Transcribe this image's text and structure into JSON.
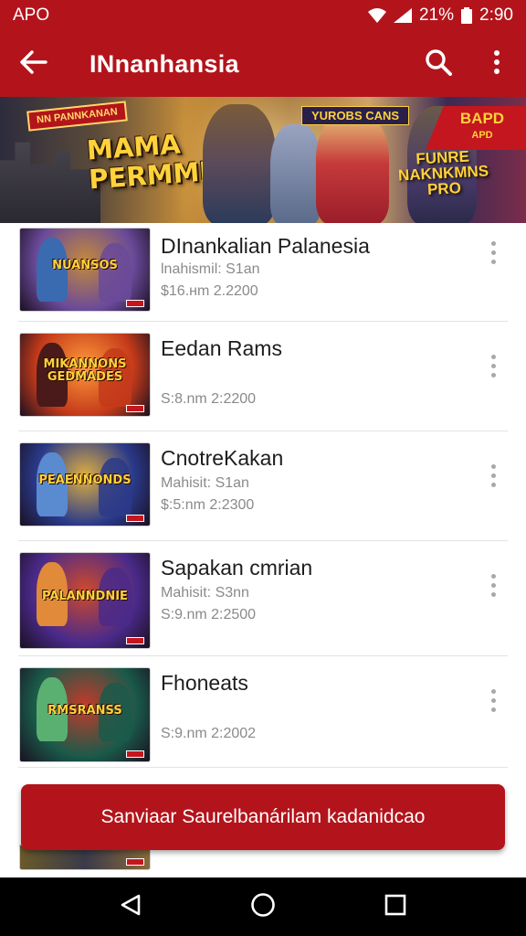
{
  "status_bar": {
    "carrier": "APO",
    "battery": "21%",
    "time": "2:90",
    "icons": [
      "wifi-icon",
      "signal-icon",
      "battery-icon"
    ]
  },
  "app_bar": {
    "title": "INnanhansia",
    "icons": [
      "back-arrow-icon",
      "search-icon",
      "more-vert-icon"
    ]
  },
  "banner": {
    "corner_tag": "NN PANNKANAN",
    "headline_line1": "MAMA",
    "headline_line2": "PERMMDES",
    "right_tag": "YUROBS CANS",
    "right_sub_line1": "FUNRE",
    "right_sub_line2": "NAKNKMNS",
    "right_sub_line3": "PRO",
    "badge_main": "BAPD",
    "badge_sub": "APD"
  },
  "items": [
    {
      "name": "DInankalian Palanesia",
      "meta": "lnahismil: S1an",
      "price": "$16.нm 2.2200",
      "art_title": "NUANSOS",
      "palette": [
        "#6a4a9a",
        "#c48a3a",
        "#3a6ab0"
      ]
    },
    {
      "name": "Eedan Rams",
      "meta": "",
      "price": "S:8.nm 2:2200",
      "art_title": "MIKANNONS GEDMADES",
      "palette": [
        "#c43a1a",
        "#ff9a3a",
        "#4a1a1a"
      ]
    },
    {
      "name": "CnotreKakan",
      "meta": "Mahisit: S1an",
      "price": "$:5:nm 2:2300",
      "art_title": "PEAENNONDS",
      "palette": [
        "#2a3a8a",
        "#e0b040",
        "#5a8ad0"
      ]
    },
    {
      "name": "Sapakan cmrian",
      "meta": "Mahisit: S3nn",
      "price": "S:9.nm 2:2500",
      "art_title": "PALANNDNIE",
      "palette": [
        "#4a2a8a",
        "#d04a2a",
        "#e08a3a"
      ]
    },
    {
      "name": "Fhoneats",
      "meta": "",
      "price": "S:9.nm 2:2002",
      "art_title": "RMSRANSS",
      "palette": [
        "#1a5a4a",
        "#c43a2a",
        "#5ab070"
      ]
    }
  ],
  "cta": {
    "label": "Sanviaar Saurelbanárilam kadanidcao"
  },
  "nav_bar": {
    "icons": [
      "back-triangle-icon",
      "home-circle-icon",
      "recents-square-icon"
    ]
  },
  "colors": {
    "brand_red": "#b3141b",
    "text_primary": "#1d1d1d",
    "text_secondary": "#8a8a8a",
    "divider": "#e3e3e3"
  }
}
